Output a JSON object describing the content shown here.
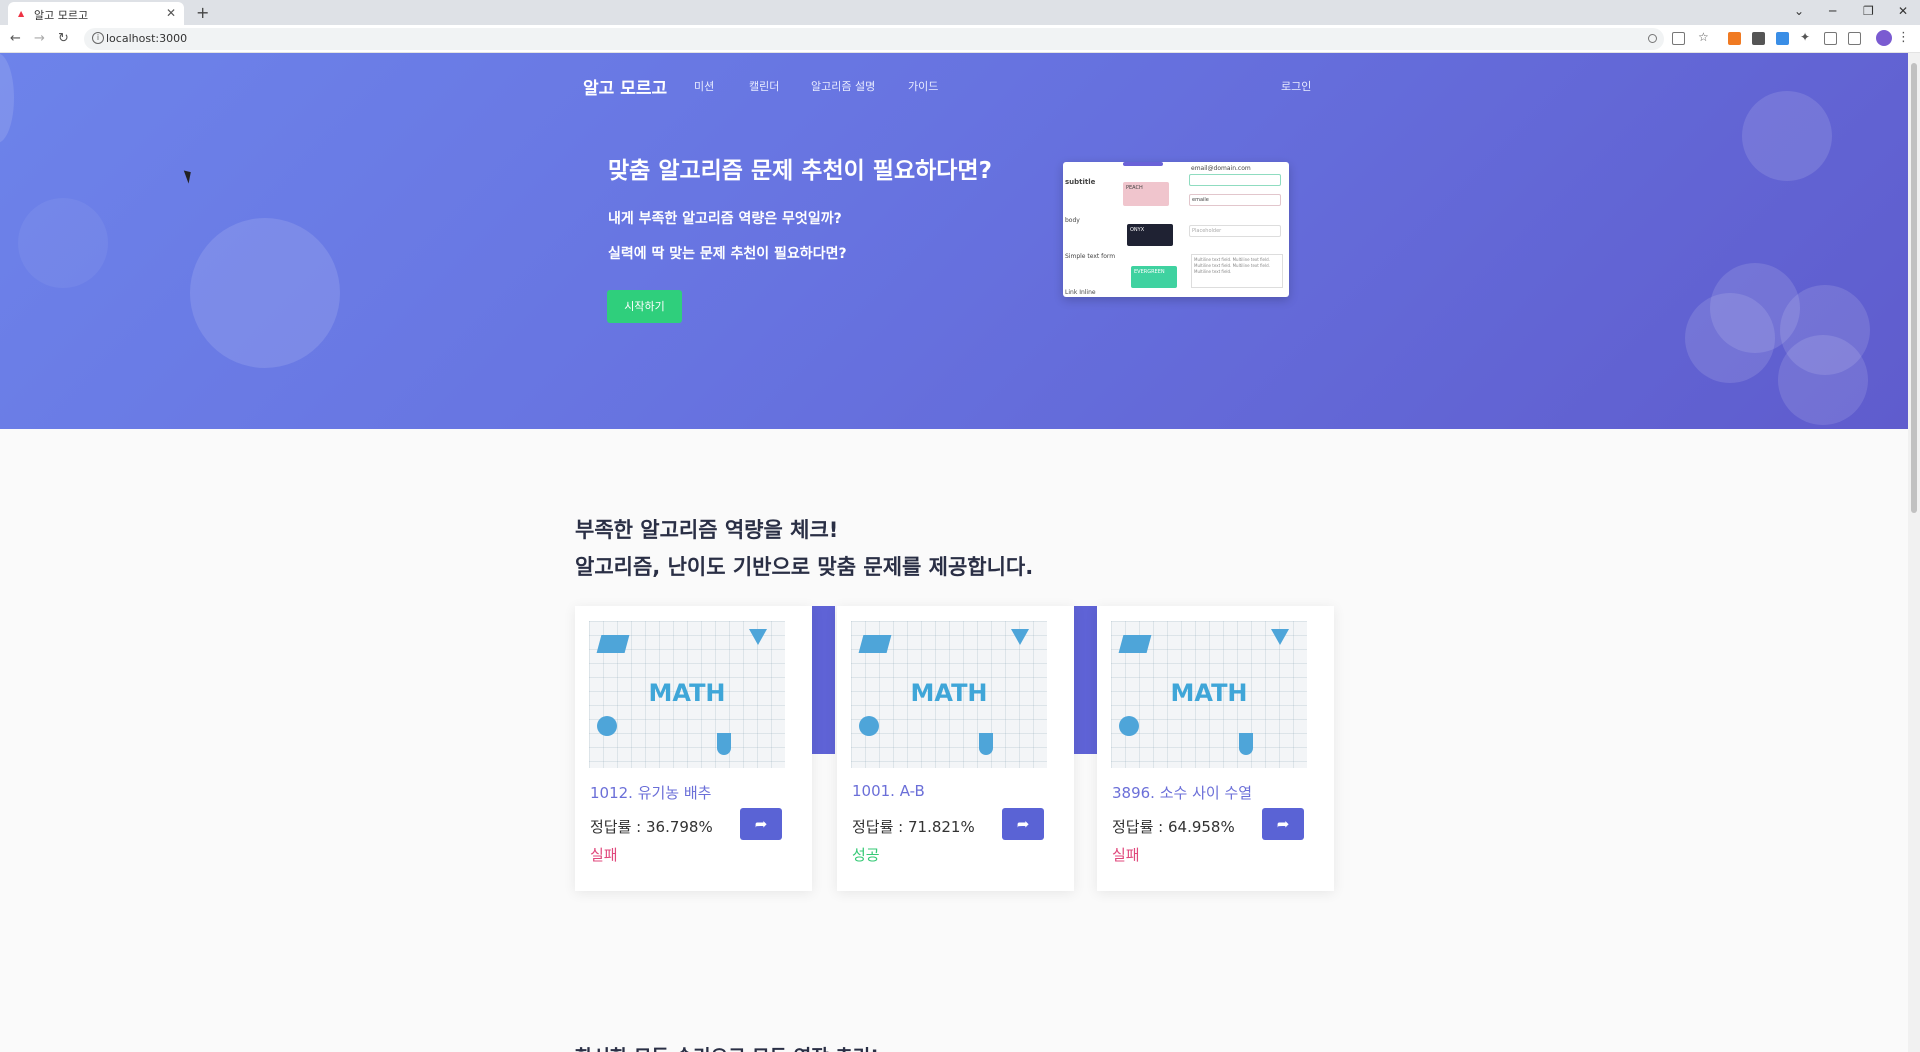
{
  "browser": {
    "tab_title": "알고 모르고",
    "tab_favicon": "▲",
    "url": "localhost:3000",
    "new_tab": "+",
    "close": "✕",
    "win_min": "─",
    "win_max": "❐",
    "win_close": "✕",
    "win_dropdown": "⌄"
  },
  "header": {
    "brand": "알고 모르고",
    "nav": [
      "미션",
      "캘린더",
      "알고리즘 설명",
      "가이드"
    ],
    "login": "로그인"
  },
  "hero": {
    "title": "맞춤 알고리즘 문제 추천이 필요하다면?",
    "subtitle1": "내게 부족한 알고리즘 역량은 무엇일까?",
    "subtitle2": "실력에 딱 맞는 문제 추천이 필요하다면?",
    "cta": "시작하기",
    "mock": {
      "label_subtitle": "subtitle",
      "label_body": "body",
      "label_simple": "Simple text form",
      "label_link": "Link Inline",
      "chip1": "PEACH",
      "chip2": "ONYX",
      "chip3": "EVERGREEN",
      "email": "email@domain.com",
      "field_value": "emaile",
      "field_placeholder": "Placeholder",
      "textarea": "Multiline text field. Multiline text field. Multiline text field. Multiline text field. Multiline text field."
    }
  },
  "section": {
    "title1": "부족한 알고리즘 역량을 체크!",
    "title2": "알고리즘, 난이도 기반으로 맞춤 문제를 제공합니다.",
    "next_title": "한시한 모든 승리으로 모두 영작 추리!"
  },
  "cards": [
    {
      "title": "1012. 유기농 배추",
      "rate": "정답률 : 36.798%",
      "status": "실패",
      "status_color": "#e0487c",
      "thumb_word": "MATH",
      "share_icon": "share-icon"
    },
    {
      "title": "1001. A-B",
      "rate": "정답률 : 71.821%",
      "status": "성공",
      "status_color": "#36c976",
      "thumb_word": "MATH",
      "share_icon": "share-icon"
    },
    {
      "title": "3896. 소수 사이 수열",
      "rate": "정답률 : 64.958%",
      "status": "실패",
      "status_color": "#e0487c",
      "thumb_word": "MATH",
      "share_icon": "share-icon"
    }
  ],
  "colors": {
    "hero_start": "#6d83ea",
    "hero_end": "#5f5ccd",
    "cta": "#2fcf7c",
    "accent": "#5a63d5",
    "fail": "#e0487c",
    "success": "#36c976"
  }
}
